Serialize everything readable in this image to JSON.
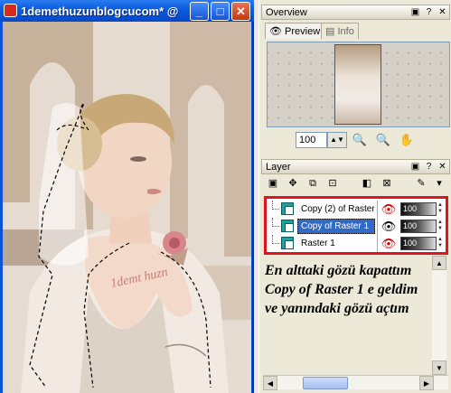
{
  "document": {
    "title": "1demethuzunblogcucom* @",
    "tattoo_text": "1demt huzn"
  },
  "overview": {
    "title": "Overview",
    "tabs": [
      {
        "label": "Preview",
        "active": true
      },
      {
        "label": "Info",
        "active": false
      }
    ],
    "zoom_value": "100"
  },
  "layer": {
    "title": "Layer",
    "rows": [
      {
        "name": "Copy (2) of Raster",
        "visible": false,
        "opacity": "100",
        "selected": false
      },
      {
        "name": "Copy of Raster 1",
        "visible": true,
        "opacity": "100",
        "selected": true
      },
      {
        "name": "Raster 1",
        "visible": false,
        "opacity": "100",
        "selected": false
      }
    ]
  },
  "note_lines": [
    "En alttaki gözü kapattım",
    "Copy of Raster 1 e geldim",
    "ve yanındaki gözü açtım"
  ],
  "colors": {
    "highlight_frame": "#e0141e",
    "selection": "#316ac5",
    "xp_titlebar": "#0b5de0"
  },
  "icons": {
    "app": "paint-app-icon",
    "preview_tab": "eye-icon",
    "info_tab": "document-icon",
    "zoom_out": "zoom-out-icon",
    "zoom_in": "zoom-in-icon",
    "pan": "hand-icon",
    "layer_visible": "eye-icon",
    "layer_hidden": "eye-crossed-icon"
  }
}
